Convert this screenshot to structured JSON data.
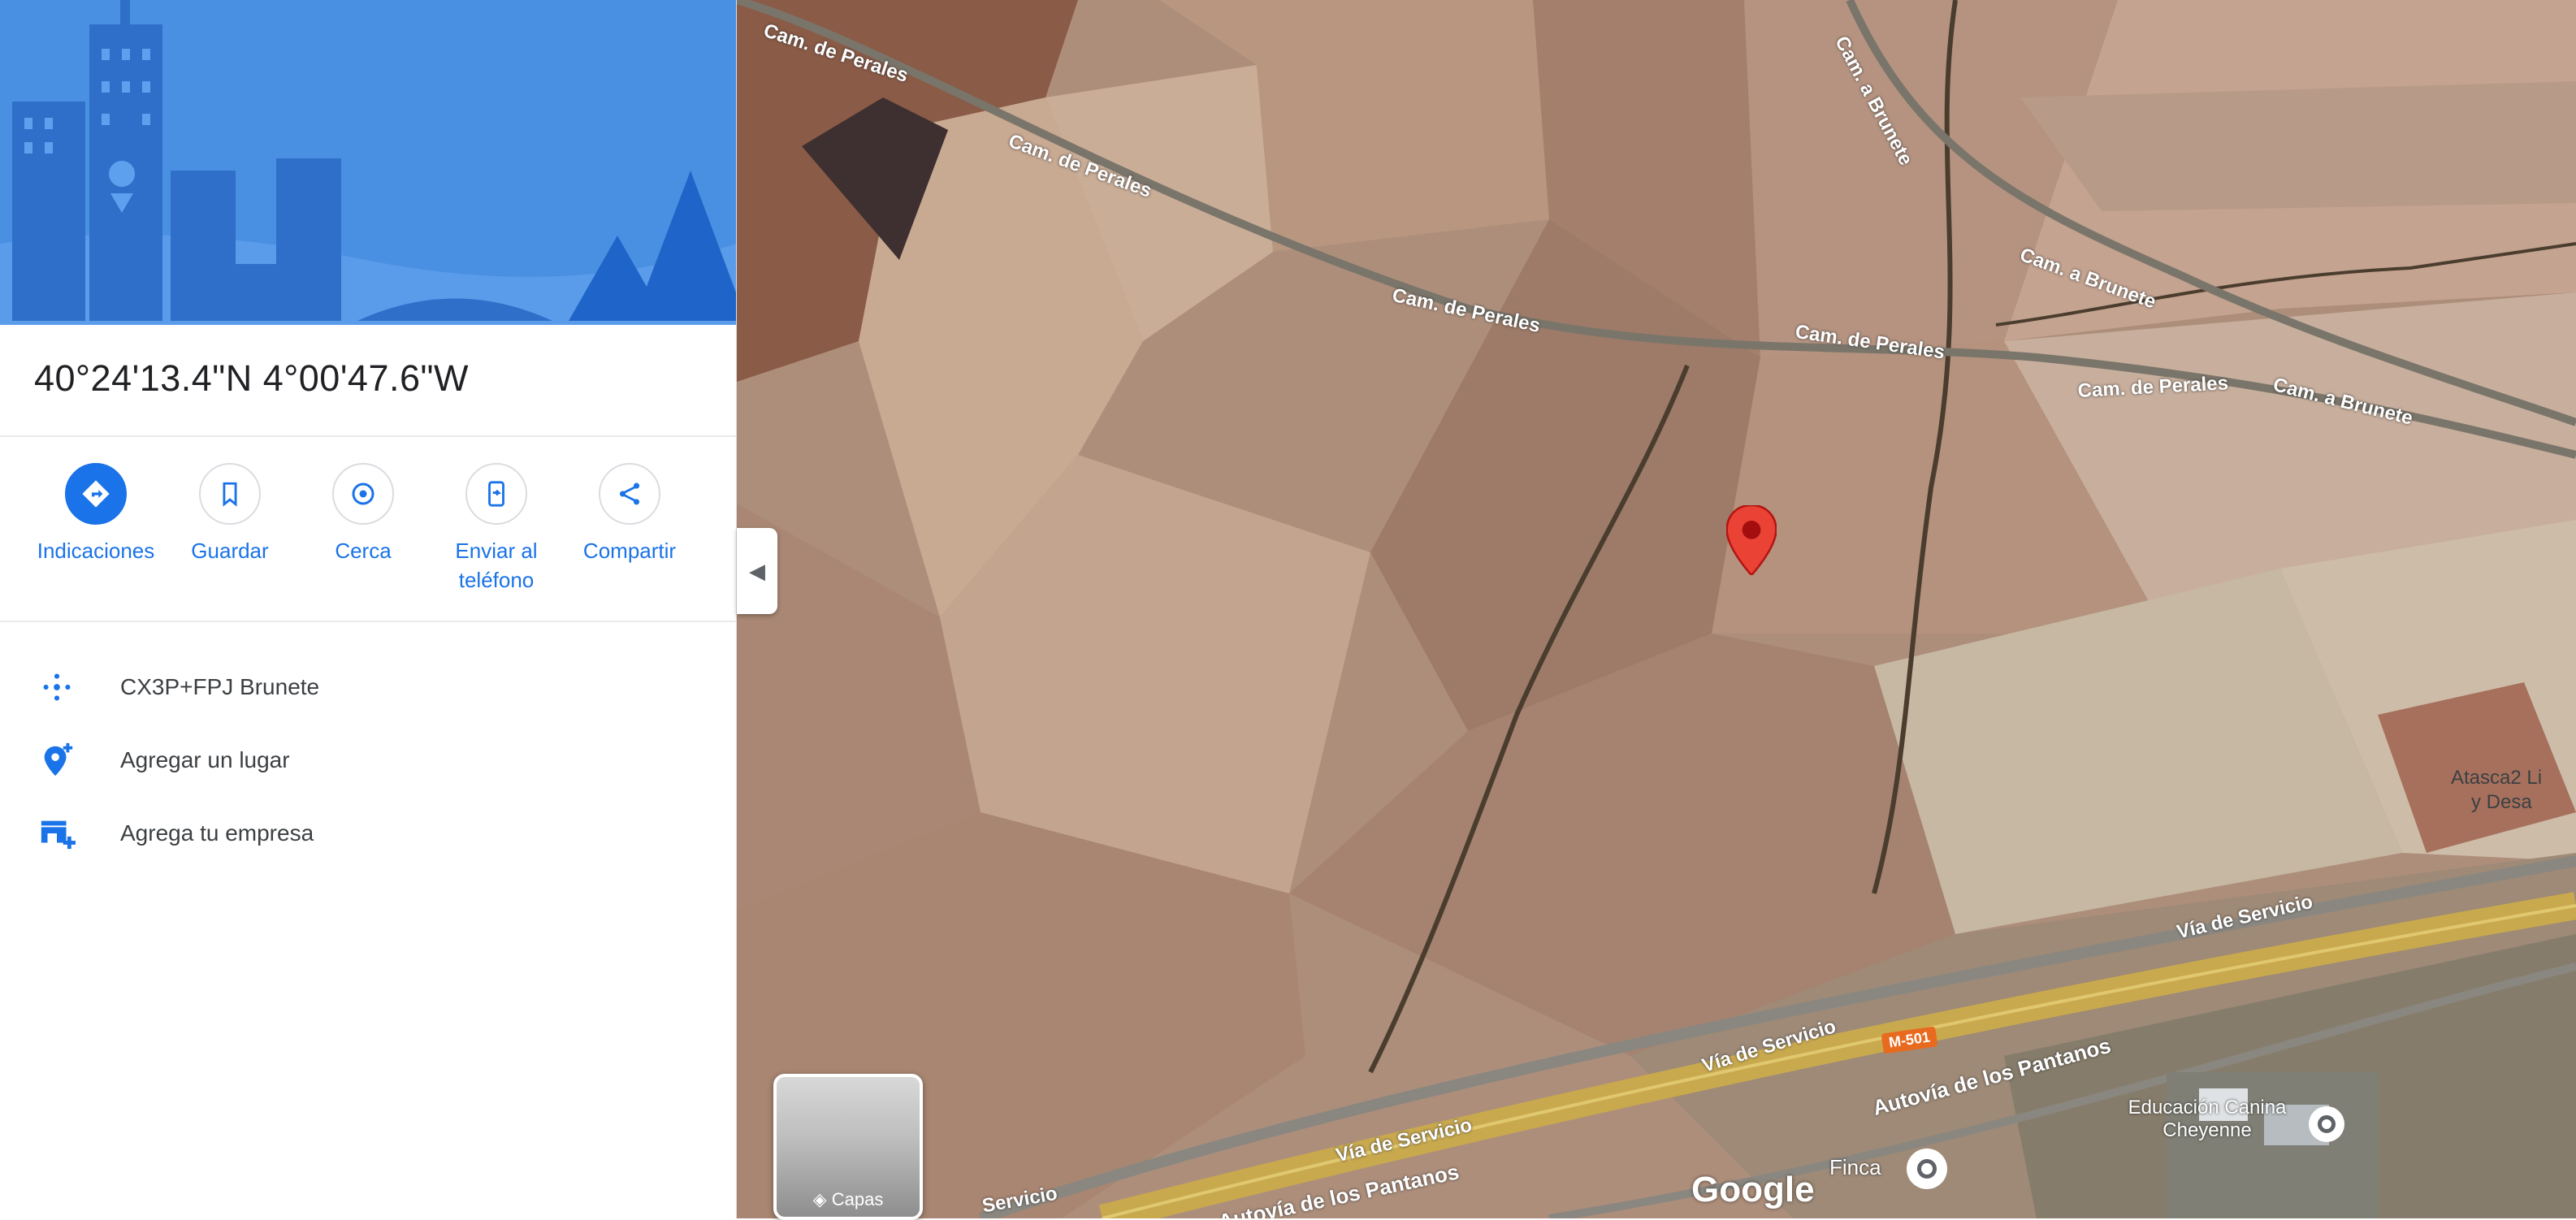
{
  "place": {
    "coordinates": "40°24'13.4\"N 4°00'47.6\"W"
  },
  "actions": [
    {
      "label": "Indicaciones",
      "icon": "directions-icon"
    },
    {
      "label": "Guardar",
      "icon": "bookmark-icon"
    },
    {
      "label": "Cerca",
      "icon": "nearby-icon"
    },
    {
      "label": "Enviar al teléfono",
      "icon": "send-to-phone-icon"
    },
    {
      "label": "Compartir",
      "icon": "share-icon"
    }
  ],
  "info_rows": [
    {
      "text": "CX3P+FPJ Brunete",
      "icon": "plus-code-icon"
    },
    {
      "text": "Agregar un lugar",
      "icon": "add-place-icon"
    },
    {
      "text": "Agrega tu empresa",
      "icon": "add-business-icon"
    }
  ],
  "map": {
    "roads": [
      "Cam. de Perales",
      "Cam. de Perales",
      "Cam. de Perales",
      "Cam. de Perales",
      "Cam. de Perales",
      "Cam. a Brunete",
      "Cam. a Brunete",
      "Cam. a Brunete",
      "Vía de Servicio",
      "Vía de Servicio",
      "Vía de Servicio",
      "Servicio",
      "Autovía de los Pantanos",
      "Autovía de los Pantanos"
    ],
    "road_shield": "M-501",
    "pois": [
      "Educación Canina Cheyenne",
      "Finca",
      "Atasca2 Li",
      "y Desa"
    ],
    "layers_label": "Capas",
    "logo": "Google",
    "colors": {
      "accent": "#1a73e8",
      "pin": "#ea4335"
    }
  }
}
